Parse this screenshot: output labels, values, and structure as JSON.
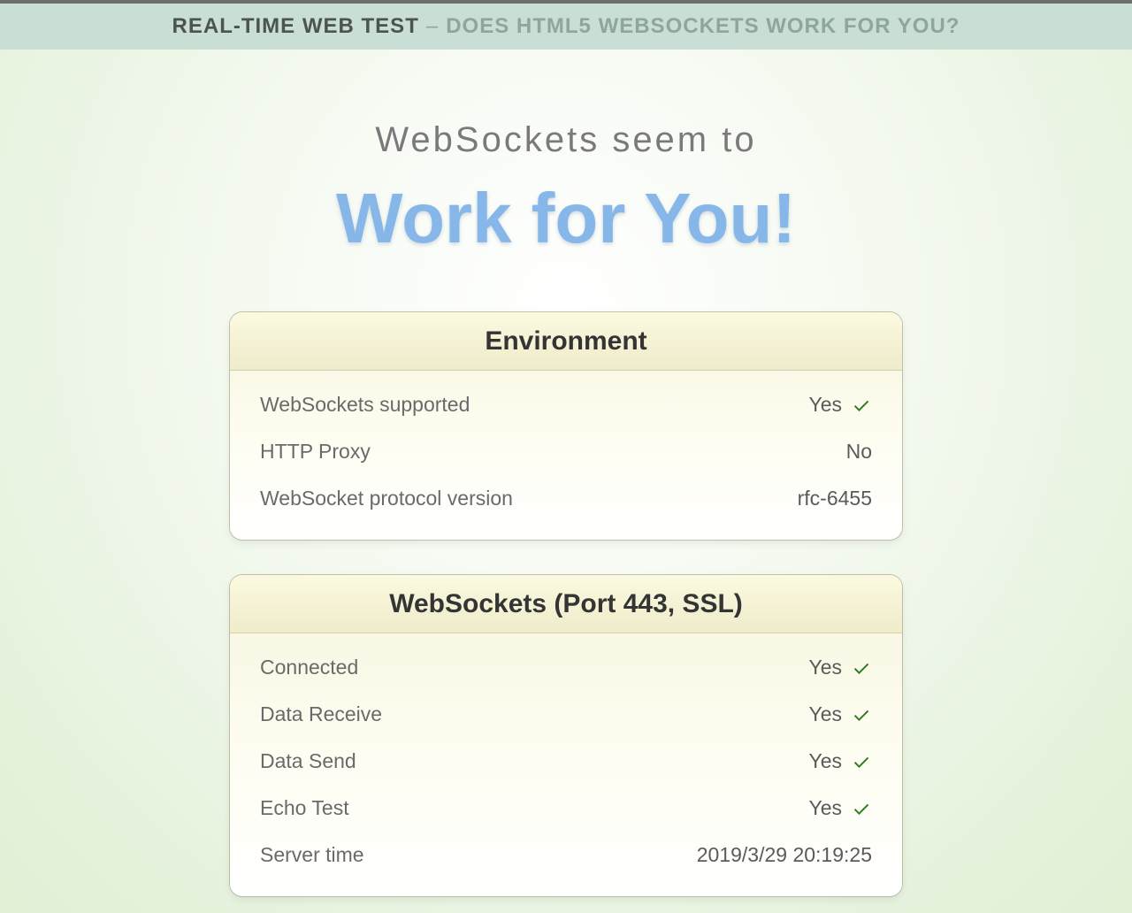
{
  "banner": {
    "strong": "REAL-TIME WEB TEST",
    "separator": "–",
    "rest": "DOES HTML5 WEBSOCKETS WORK FOR YOU?"
  },
  "headline": {
    "lead": "WebSockets seem to",
    "main": "Work for You!"
  },
  "panels": {
    "environment": {
      "title": "Environment",
      "rows": {
        "ws_supported": {
          "label": "WebSockets supported",
          "value": "Yes",
          "check": true
        },
        "http_proxy": {
          "label": "HTTP Proxy",
          "value": "No",
          "check": false
        },
        "protocol_ver": {
          "label": "WebSocket protocol version",
          "value": "rfc-6455",
          "check": false
        }
      }
    },
    "ws443": {
      "title": "WebSockets (Port 443, SSL)",
      "rows": {
        "connected": {
          "label": "Connected",
          "value": "Yes",
          "check": true
        },
        "data_recv": {
          "label": "Data Receive",
          "value": "Yes",
          "check": true
        },
        "data_send": {
          "label": "Data Send",
          "value": "Yes",
          "check": true
        },
        "echo_test": {
          "label": "Echo Test",
          "value": "Yes",
          "check": true
        },
        "server_time": {
          "label": "Server time",
          "value": "2019/3/29 20:19:25",
          "check": false
        }
      }
    }
  }
}
